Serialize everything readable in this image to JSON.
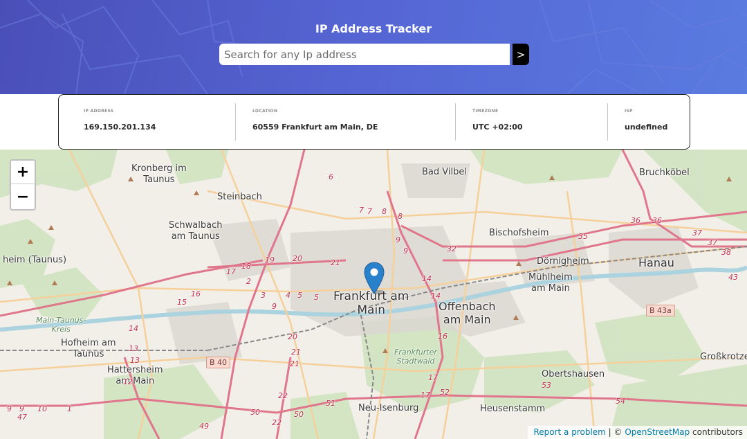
{
  "header": {
    "title": "IP Address Tracker",
    "search_placeholder": "Search for any Ip address",
    "search_button_label": ">"
  },
  "info": {
    "ip_label": "IP ADDRESS",
    "ip_value": "169.150.201.134",
    "location_label": "LOCATION",
    "location_value": "60559 Frankfurt am Main, DE",
    "timezone_label": "TIMEZONE",
    "timezone_value": "UTC +02:00",
    "isp_label": "ISP",
    "isp_value": "undefined"
  },
  "map": {
    "zoom_in_label": "+",
    "zoom_out_label": "−",
    "attribution": {
      "report": "Report a problem",
      "separator": " | © ",
      "osm": "OpenStreetMap",
      "contributors": " contributors"
    },
    "labels": {
      "kronberg": "Kronberg im\nTaunus",
      "steinbach": "Steinbach",
      "schwalbach": "Schwalbach\nam Taunus",
      "heim": "heim (Taunus)",
      "main_taunus": "Main-Taunus-\nKreis",
      "hofheim": "Hofheim am\nTaunus",
      "hattersheim": "Hattersheim\nam Main",
      "bad_vilbel": "Bad Vilbel",
      "bruchkoebel": "Bruchköbel",
      "bischofsheim": "Bischofsheim",
      "doernigheim": "Dörnigheim",
      "muehlheim": "Mühlheim\nam Main",
      "hanau": "Hanau",
      "frankfurt": "Frankfurt am\nMain",
      "offenbach": "Offenbach\nam Main",
      "frankfurter_stadtwald": "Frankfurter\nStadtwald",
      "obertshausen": "Obertshausen",
      "heusenstamm": "Heusenstamm",
      "neu_isenburg": "Neu-Isenburg",
      "grosskrotzenburg": "Großkrotze",
      "b40": "B 40",
      "b43a": "B 43a"
    },
    "road_numbers": [
      "6",
      "7",
      "7",
      "8",
      "8",
      "9",
      "9",
      "32",
      "35",
      "36",
      "36",
      "37",
      "37",
      "38",
      "43",
      "21",
      "20",
      "19",
      "18",
      "17",
      "2",
      "16",
      "15",
      "3",
      "9",
      "4",
      "5",
      "5",
      "14",
      "14",
      "16",
      "17",
      "17",
      "52",
      "53",
      "54",
      "20",
      "21",
      "21",
      "22",
      "22",
      "49",
      "50",
      "50",
      "51",
      "13",
      "13",
      "14",
      "12",
      "10",
      "9",
      "9",
      "47",
      "1"
    ]
  },
  "colors": {
    "header_start": "#4a4fb8",
    "header_end": "#5a7be0",
    "map_background": "#f2efe9",
    "road_primary": "#e892a2",
    "road_secondary": "#f7d6a5",
    "forest": "#c8dfb8",
    "marker": "#2a81cb"
  }
}
